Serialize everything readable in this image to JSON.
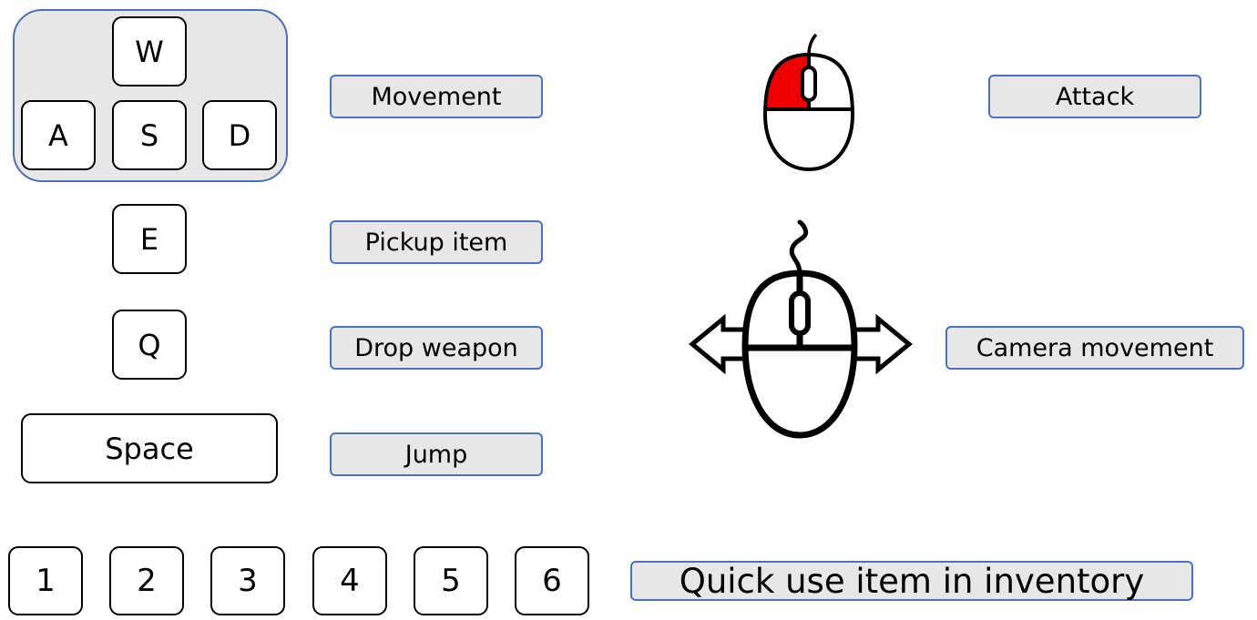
{
  "keys": {
    "w": "W",
    "a": "A",
    "s": "S",
    "d": "D",
    "e": "E",
    "q": "Q",
    "space": "Space",
    "num": [
      "1",
      "2",
      "3",
      "4",
      "5",
      "6"
    ]
  },
  "labels": {
    "movement": "Movement",
    "pickup": "Pickup item",
    "drop": "Drop weapon",
    "jump": "Jump",
    "attack": "Attack",
    "camera": "Camera movement",
    "quick_use": "Quick use item in inventory"
  },
  "icons": {
    "left_click": "mouse-left-click-icon",
    "mouse_move": "mouse-move-horizontal-icon"
  },
  "colors": {
    "key_border": "#000000",
    "label_fill": "#e7e7e7",
    "label_border": "#4a72c0",
    "left_button_highlight": "#ee0000"
  }
}
